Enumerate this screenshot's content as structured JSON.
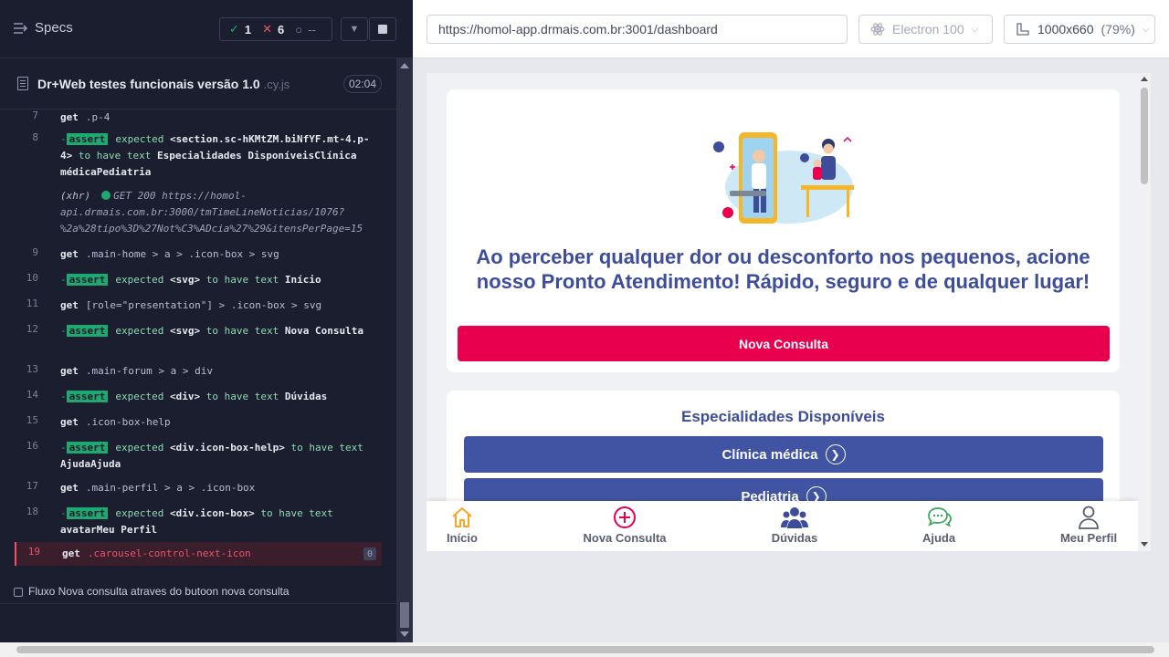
{
  "reporter": {
    "specs_label": "Specs",
    "passed": "1",
    "failed": "6",
    "pending": "--",
    "file_name": "Dr+Web testes funcionais versão 1.0",
    "file_ext": ".cy.js",
    "duration": "02:04",
    "commands": [
      {
        "num": "7",
        "kind": "get",
        "name": "get",
        "selector": ".p-4"
      },
      {
        "num": "8",
        "kind": "assert",
        "pre": "expected",
        "subject": "<section.sc-hKMtZM.biNfYF.mt-4.p-4>",
        "mid": "to have text",
        "value": "Especialidades DisponíveisClínica médicaPediatria"
      },
      {
        "num": "",
        "kind": "xhr",
        "label": "(xhr)",
        "text": "GET 200 https://homol-api.drmais.com.br:3000/tmTimeLineNoticias/1076?%2a%28tipo%3D%27Not%C3%ADcia%27%29&itensPerPage=15"
      },
      {
        "num": "9",
        "kind": "get",
        "name": "get",
        "selector": ".main-home > a > .icon-box > svg"
      },
      {
        "num": "10",
        "kind": "assert",
        "pre": "expected",
        "subject": "<svg>",
        "mid": "to have text",
        "value": "Início"
      },
      {
        "num": "11",
        "kind": "get",
        "name": "get",
        "selector": "[role=\"presentation\"] > .icon-box > svg"
      },
      {
        "num": "12",
        "kind": "assert",
        "pre": "expected",
        "subject": "<svg>",
        "mid": "to have text",
        "value": "Nova Consulta"
      },
      {
        "num": "13",
        "kind": "get",
        "name": "get",
        "selector": ".main-forum > a > div"
      },
      {
        "num": "14",
        "kind": "assert",
        "pre": "expected",
        "subject": "<div>",
        "mid": "to have text",
        "value": "Dúvidas"
      },
      {
        "num": "15",
        "kind": "get",
        "name": "get",
        "selector": ".icon-box-help"
      },
      {
        "num": "16",
        "kind": "assert",
        "pre": "expected",
        "subject": "<div.icon-box-help>",
        "mid": "to have text",
        "value": "AjudaAjuda"
      },
      {
        "num": "17",
        "kind": "get",
        "name": "get",
        "selector": ".main-perfil > a > .icon-box"
      },
      {
        "num": "18",
        "kind": "assert",
        "pre": "expected",
        "subject": "<div.icon-box>",
        "mid": "to have text",
        "value": "avatarMeu Perfil"
      },
      {
        "num": "19",
        "kind": "active",
        "name": "get",
        "selector": ".carousel-control-next-icon",
        "count": "0"
      }
    ],
    "assert_label": "assert",
    "second_test": "Fluxo Nova consulta atraves do butoon nova consulta",
    "colors": {
      "pass": "#1fa971",
      "fail": "#e45770"
    }
  },
  "aut": {
    "url": "https://homol-app.drmais.com.br:3001/dashboard",
    "browser": "Electron 100",
    "viewport": "1000x660",
    "viewport_scale": "(79%)"
  },
  "app": {
    "promo_text": "Ao perceber qualquer dor ou desconforto nos pequenos, acione nosso Pronto Atendimento! Rápido, seguro e de qualquer lugar!",
    "nova_consulta_button": "Nova Consulta",
    "specialties_title": "Especialidades Disponíveis",
    "specialties": [
      "Clínica médica",
      "Pediatria"
    ],
    "nav": [
      {
        "label": "Início",
        "icon": "home-icon"
      },
      {
        "label": "Nova Consulta",
        "icon": "plus-circle-icon"
      },
      {
        "label": "Dúvidas",
        "icon": "users-icon"
      },
      {
        "label": "Ajuda",
        "icon": "chat-icon"
      },
      {
        "label": "Meu Perfil",
        "icon": "user-icon"
      }
    ],
    "colors": {
      "primary": "#3e4d9a",
      "accent": "#e8004f",
      "specialty": "#4054a3",
      "home": "#f5a623"
    }
  }
}
